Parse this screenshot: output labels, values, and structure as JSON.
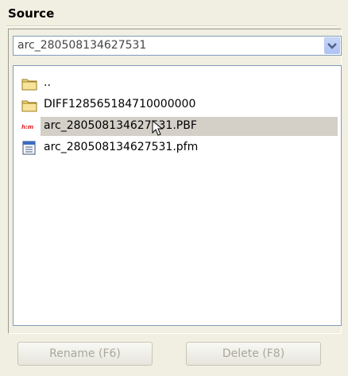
{
  "section": {
    "title": "Source"
  },
  "combo": {
    "value": "arc_280508134627531"
  },
  "files": [
    {
      "name": "..",
      "icon": "folder-icon"
    },
    {
      "name": "DIFF128565184710000000",
      "icon": "folder-icon"
    },
    {
      "name": "arc_280508134627531.PBF",
      "icon": "pbf-file-icon",
      "selected": true
    },
    {
      "name": "arc_280508134627531.pfm",
      "icon": "pfm-file-icon"
    }
  ],
  "buttons": {
    "rename": "Rename (F6)",
    "delete": "Delete (F8)"
  },
  "colors": {
    "background": "#f1efe2",
    "selection": "#d4d0c8",
    "field_border": "#7f9db9",
    "disabled_text": "#a9a899"
  }
}
